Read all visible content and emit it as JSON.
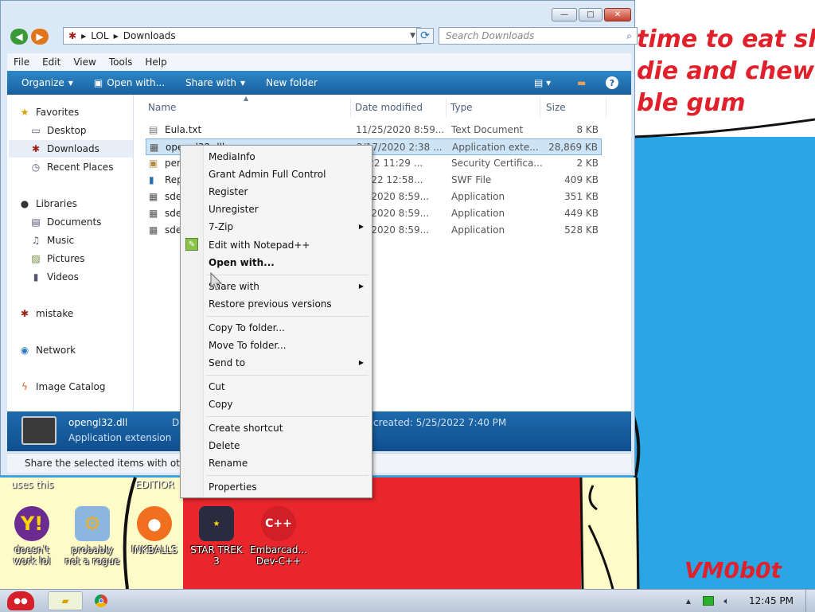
{
  "window": {
    "minimize": "—",
    "maximize": "□",
    "close": "✕",
    "breadcrumb": [
      "LOL",
      "Downloads"
    ],
    "search_placeholder": "Search Downloads",
    "menu": [
      "File",
      "Edit",
      "View",
      "Tools",
      "Help"
    ],
    "toolbar": {
      "organize": "Organize",
      "open_with": "Open with...",
      "share_with": "Share with",
      "new_folder": "New folder"
    }
  },
  "sidebar": {
    "items": [
      {
        "label": "Favorites",
        "icon": "star-icon"
      },
      {
        "label": "Desktop",
        "icon": "desktop-icon"
      },
      {
        "label": "Downloads",
        "icon": "downloads-icon"
      },
      {
        "label": "Recent Places",
        "icon": "recent-icon"
      },
      {
        "label": "Libraries",
        "icon": "libraries-icon"
      },
      {
        "label": "Documents",
        "icon": "documents-icon"
      },
      {
        "label": "Music",
        "icon": "music-icon"
      },
      {
        "label": "Pictures",
        "icon": "pictures-icon"
      },
      {
        "label": "Videos",
        "icon": "videos-icon"
      },
      {
        "label": "mistake",
        "icon": "user-icon"
      },
      {
        "label": "Network",
        "icon": "network-icon"
      },
      {
        "label": "Image Catalog",
        "icon": "catalog-icon"
      }
    ]
  },
  "columns": [
    "Name",
    "Date modified",
    "Type",
    "Size"
  ],
  "files": [
    {
      "name": "Eula.txt",
      "date": "11/25/2020 8:59...",
      "type": "Text Document",
      "size": "8 KB"
    },
    {
      "name": "opengl32.dll",
      "date": "2/17/2020 2:38 ...",
      "type": "Application exte...",
      "size": "28,869 KB"
    },
    {
      "name": "per",
      "date": "2022 11:29 ...",
      "type": "Security Certifica...",
      "size": "2 KB"
    },
    {
      "name": "Rep",
      "date": "/2022 12:58...",
      "type": "SWF File",
      "size": "409 KB"
    },
    {
      "name": "sde",
      "date": "25/2020 8:59...",
      "type": "Application",
      "size": "351 KB"
    },
    {
      "name": "sde",
      "date": "25/2020 8:59...",
      "type": "Application",
      "size": "449 KB"
    },
    {
      "name": "sde",
      "date": "25/2020 8:59...",
      "type": "Application",
      "size": "528 KB"
    }
  ],
  "details": {
    "filename": "opengl32.dll",
    "filetype": "Application extension",
    "prefix": "Da",
    "created": "created: 5/25/2022 7:40 PM"
  },
  "status": "Share the selected items with othe",
  "context_menu": {
    "groups": [
      [
        {
          "label": "MediaInfo"
        },
        {
          "label": "Grant Admin Full Control"
        },
        {
          "label": "Register"
        },
        {
          "label": "Unregister"
        },
        {
          "label": "7-Zip",
          "submenu": true
        },
        {
          "label": "Edit with Notepad++",
          "icon": "notepad-icon"
        },
        {
          "label": "Open with...",
          "bold": true
        }
      ],
      [
        {
          "label": "Share with",
          "submenu": true
        },
        {
          "label": "Restore previous versions"
        }
      ],
      [
        {
          "label": "Copy To folder..."
        },
        {
          "label": "Move To folder..."
        },
        {
          "label": "Send to",
          "submenu": true
        }
      ],
      [
        {
          "label": "Cut"
        },
        {
          "label": "Copy"
        }
      ],
      [
        {
          "label": "Create shortcut"
        },
        {
          "label": "Delete"
        },
        {
          "label": "Rename"
        }
      ],
      [
        {
          "label": "Properties"
        }
      ]
    ]
  },
  "wallpaper": {
    "lines": [
      "time to eat shit",
      "die and chew",
      "ble gum"
    ],
    "signature": "VM0b0t",
    "labels": [
      "uses this",
      "EDITIOR"
    ]
  },
  "desktop_icons": [
    {
      "label": "doesn't work lol",
      "icon": "yahoo-messenger-icon"
    },
    {
      "label": "probably not a rogue",
      "icon": "gear-monitor-icon"
    },
    {
      "label": "INKBALLS",
      "icon": "inkball-icon"
    },
    {
      "label": "STAR TREK 3",
      "icon": "star-wars-icon"
    },
    {
      "label": "Embarcad... Dev-C++",
      "icon": "dev-cpp-icon"
    }
  ],
  "taskbar": {
    "clock": "12:45 PM",
    "buttons": [
      "start-button",
      "explorer-button",
      "chrome-button"
    ]
  },
  "colors": {
    "accent": "#1a5f9e",
    "wallpaper_blue": "#2aa6e6",
    "wallpaper_red": "#e8262b",
    "wallpaper_yellow": "#fffbc8",
    "selection": "#cde4f7"
  }
}
